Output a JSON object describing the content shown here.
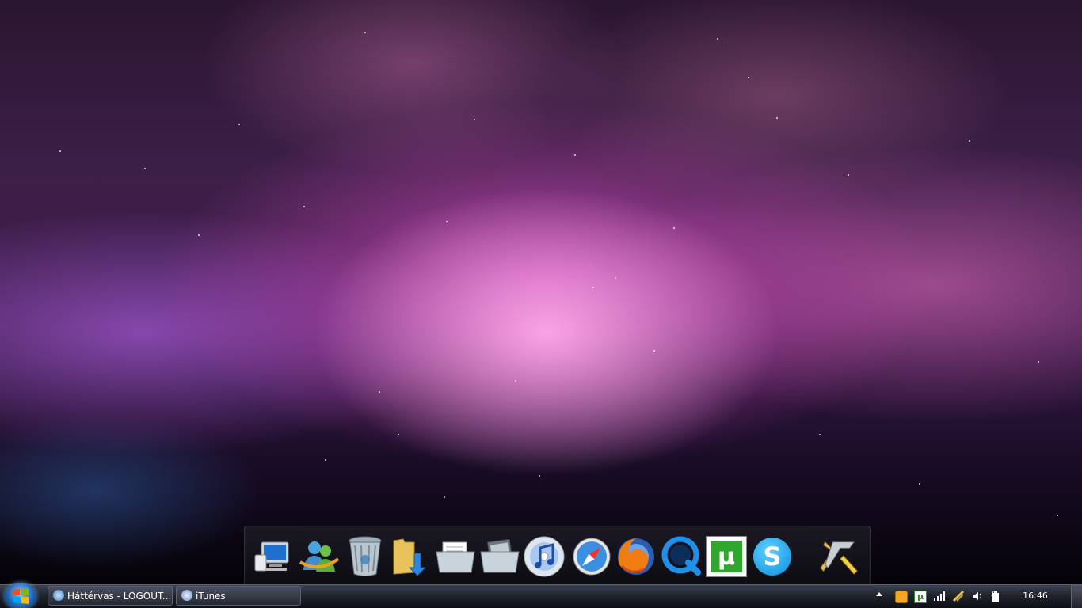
{
  "desktop": {
    "dock_items": [
      {
        "name": "computer-icon"
      },
      {
        "name": "messenger-icon"
      },
      {
        "name": "recycle-bin-icon"
      },
      {
        "name": "downloads-folder-icon"
      },
      {
        "name": "documents-folder-icon"
      },
      {
        "name": "pictures-folder-icon"
      },
      {
        "name": "itunes-icon"
      },
      {
        "name": "safari-icon"
      },
      {
        "name": "firefox-icon"
      },
      {
        "name": "quicktime-icon"
      },
      {
        "name": "utorrent-icon",
        "glyph": "µ"
      },
      {
        "name": "skype-icon",
        "glyph": "S"
      },
      {
        "name": "tools-icon"
      }
    ]
  },
  "taskbar": {
    "start_button": {
      "icon": "windows-logo-icon"
    },
    "tasks": [
      {
        "label": "Háttérvas - LOGOUT....",
        "icon": "browser-icon"
      },
      {
        "label": "iTunes",
        "icon": "itunes-icon"
      }
    ],
    "tray": {
      "icons": [
        "show-hidden-icons-arrow",
        "orange-app-icon",
        "utorrent-tray-icon",
        "signal-icon",
        "network-icon",
        "volume-icon",
        "power-icon"
      ],
      "utorrent_glyph": "µ"
    },
    "clock": "16:46"
  }
}
